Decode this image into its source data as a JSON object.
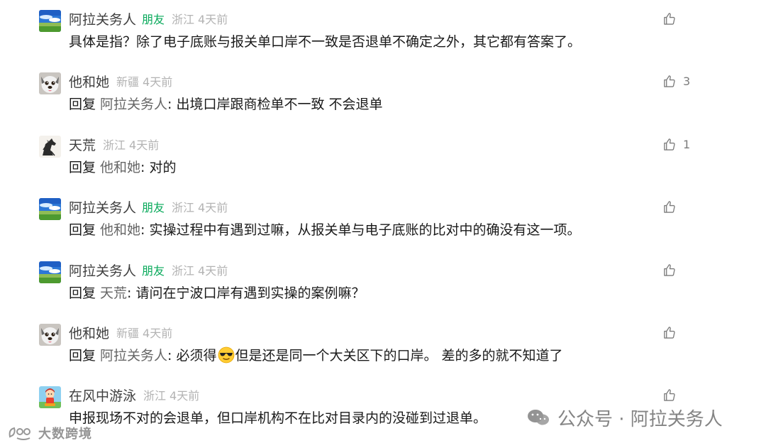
{
  "comments": [
    {
      "name": "阿拉关务人",
      "tag": "朋友",
      "location": "浙江",
      "time": "4天前",
      "text": "具体是指？除了电子底账与报关单口岸不一致是否退单不确定之外，其它都有答案了。",
      "like_count": ""
    },
    {
      "name": "他和她",
      "tag": "",
      "location": "新疆",
      "time": "4天前",
      "reply_prefix": "回复",
      "reply_to": "阿拉关务人",
      "reply_colon": ":",
      "text": "出境口岸跟商检单不一致 不会退单",
      "like_count": "3"
    },
    {
      "name": "天荒",
      "tag": "",
      "location": "浙江",
      "time": "4天前",
      "reply_prefix": "回复",
      "reply_to": "他和她",
      "reply_colon": ":",
      "text": "对的",
      "like_count": "1"
    },
    {
      "name": "阿拉关务人",
      "tag": "朋友",
      "location": "浙江",
      "time": "4天前",
      "reply_prefix": "回复",
      "reply_to": "他和她",
      "reply_colon": ":",
      "text": "实操过程中有遇到过嘛，从报关单与电子底账的比对中的确没有这一项。",
      "like_count": ""
    },
    {
      "name": "阿拉关务人",
      "tag": "朋友",
      "location": "浙江",
      "time": "4天前",
      "reply_prefix": "回复",
      "reply_to": "天荒",
      "reply_colon": ":",
      "text": "请问在宁波口岸有遇到实操的案例嘛？",
      "like_count": ""
    },
    {
      "name": "他和她",
      "tag": "",
      "location": "新疆",
      "time": "4天前",
      "reply_prefix": "回复",
      "reply_to": "阿拉关务人",
      "reply_colon": ":",
      "text_before_emoji": "必须得",
      "emoji": "sunglasses-emoji",
      "text_after_emoji": "但是还是同一个大关区下的口岸。  差的多的就不知道了",
      "like_count": ""
    },
    {
      "name": "在风中游泳",
      "tag": "",
      "location": "浙江",
      "time": "4天前",
      "text": "申报现场不对的会退单，但口岸机构不在比对目录内的没碰到过退单。",
      "like_count": ""
    }
  ],
  "watermarks": {
    "left": "大数跨境",
    "right": "公众号 · 阿拉关务人"
  },
  "colors": {
    "friend_tag": "#07a95a",
    "meta_gray": "#b3b3b3",
    "reply_target_gray": "#666666",
    "like_gray": "#7c7c7c"
  },
  "icons": {
    "like": "thumbs-up-icon",
    "avatar_landscape": "landscape-avatar",
    "avatar_dog": "dog-avatar",
    "avatar_horse": "horse-avatar",
    "avatar_cartoon": "cartoon-avatar"
  }
}
